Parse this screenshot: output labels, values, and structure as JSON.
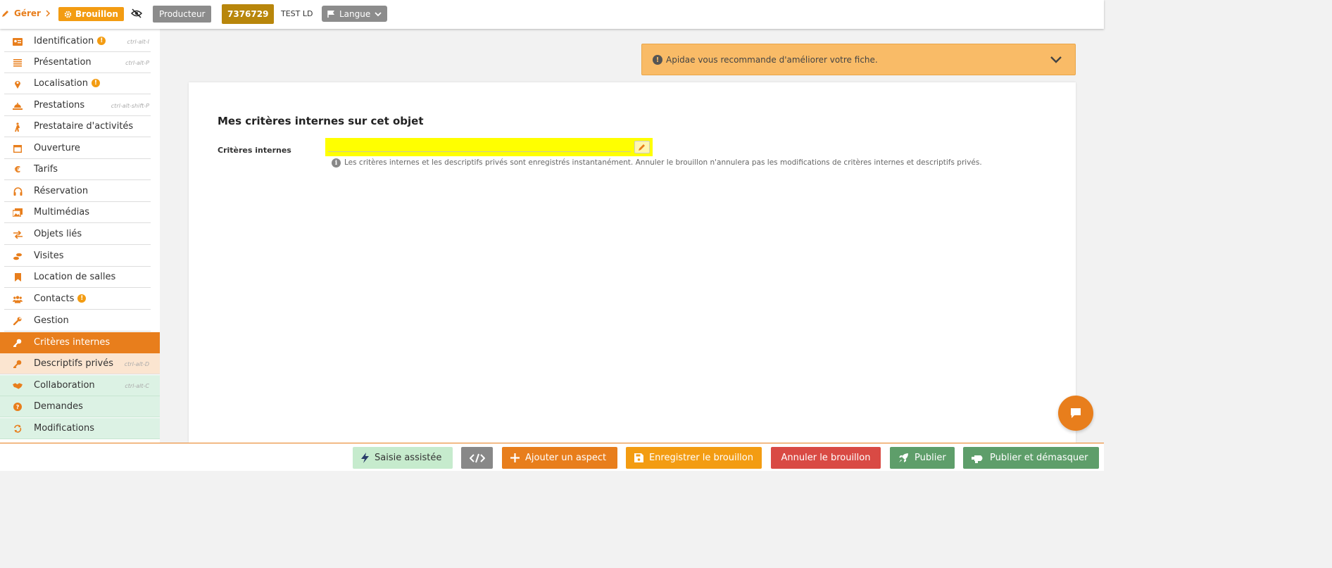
{
  "topbar": {
    "gerer": "Gérer",
    "brouillon": "Brouillon",
    "producteur": "Producteur",
    "object_id": "7376729",
    "object_name": "TEST LD",
    "langue": "Langue"
  },
  "sidebar": {
    "items": [
      {
        "label": "Identification",
        "shortcut": "ctrl-alt-I",
        "icon": "id-card-icon"
      },
      {
        "label": "Présentation",
        "shortcut": "ctrl-alt-P",
        "icon": "list-icon"
      },
      {
        "label": "Localisation",
        "shortcut": "",
        "icon": "map-marker-icon"
      },
      {
        "label": "Prestations",
        "shortcut": "ctrl-alt-shift-P",
        "icon": "bell-icon"
      },
      {
        "label": "Prestataire d'activités",
        "shortcut": "",
        "icon": "hiking-icon"
      },
      {
        "label": "Ouverture",
        "shortcut": "",
        "icon": "calendar-icon"
      },
      {
        "label": "Tarifs",
        "shortcut": "",
        "icon": "euro-icon"
      },
      {
        "label": "Réservation",
        "shortcut": "",
        "icon": "headset-icon"
      },
      {
        "label": "Multimédias",
        "shortcut": "",
        "icon": "images-icon"
      },
      {
        "label": "Objets liés",
        "shortcut": "",
        "icon": "exchange-icon"
      },
      {
        "label": "Visites",
        "shortcut": "",
        "icon": "footprints-icon"
      },
      {
        "label": "Location de salles",
        "shortcut": "",
        "icon": "bookmark-icon"
      },
      {
        "label": "Contacts",
        "shortcut": "",
        "icon": "users-icon"
      },
      {
        "label": "Gestion",
        "shortcut": "",
        "icon": "wrench-icon"
      },
      {
        "label": "Critères internes",
        "shortcut": "",
        "icon": "key-icon"
      },
      {
        "label": "Descriptifs privés",
        "shortcut": "ctrl-alt-D",
        "icon": "key-icon"
      },
      {
        "label": "Collaboration",
        "shortcut": "ctrl-alt-C",
        "icon": "handshake-icon"
      },
      {
        "label": "Demandes",
        "shortcut": "",
        "icon": "question-circle-icon"
      },
      {
        "label": "Modifications",
        "shortcut": "",
        "icon": "sync-icon"
      }
    ]
  },
  "alert": {
    "text": "Apidae vous recommande d'améliorer votre fiche."
  },
  "main": {
    "title": "Mes critères internes sur cet objet",
    "field_label": "Critères internes",
    "info_text": "Les critères internes et les descriptifs privés sont enregistrés instantanément. Annuler le brouillon n'annulera pas les modifications de critères internes et descriptifs privés."
  },
  "bottombar": {
    "saisie": "Saisie assistée",
    "ajouter": "Ajouter un aspect",
    "enregistrer": "Enregistrer le brouillon",
    "annuler": "Annuler le brouillon",
    "publier": "Publier",
    "publier_demasquer": "Publier et démasquer"
  },
  "colors": {
    "accent": "#e87e1c",
    "draft": "#f39c12",
    "alert_bg": "#f9bb67",
    "highlight": "#ffff00",
    "danger": "#d94a44",
    "success": "#5e9e6a"
  }
}
